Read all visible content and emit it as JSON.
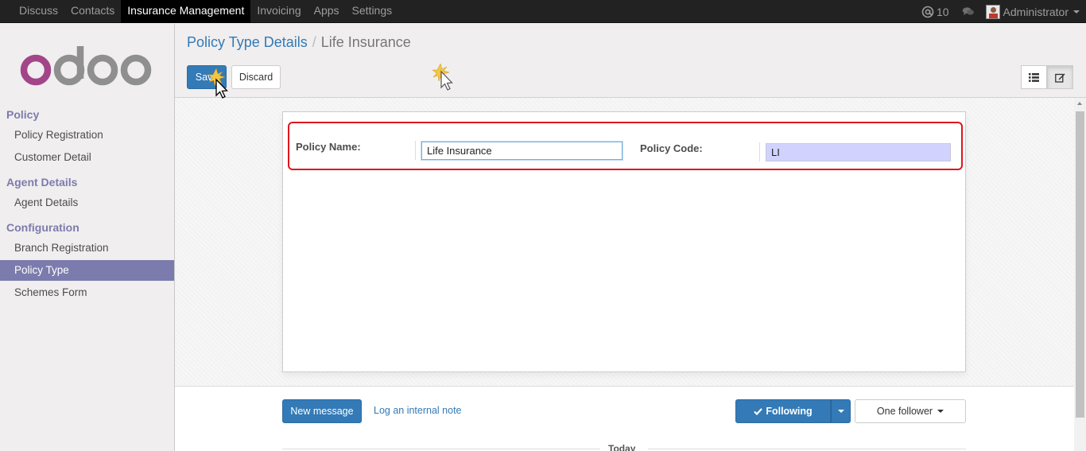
{
  "topbar": {
    "menu": [
      "Discuss",
      "Contacts",
      "Insurance Management",
      "Invoicing",
      "Apps",
      "Settings"
    ],
    "notifications": "10",
    "user": "Administrator",
    "icons": {
      "notif": "at-icon",
      "chat": "chat-icon"
    }
  },
  "sidebar": {
    "logo_text": "odoo",
    "sections": [
      {
        "title": "Policy",
        "items": [
          "Policy Registration",
          "Customer Detail"
        ]
      },
      {
        "title": "Agent Details",
        "items": [
          "Agent Details"
        ]
      },
      {
        "title": "Configuration",
        "items": [
          "Branch Registration",
          "Policy Type",
          "Schemes Form"
        ]
      }
    ],
    "active_item": "Policy Type"
  },
  "breadcrumb": {
    "parent": "Policy Type Details",
    "separator": "/",
    "current": "Life Insurance"
  },
  "buttons": {
    "save": "Save",
    "discard": "Discard"
  },
  "form": {
    "policy_name_label": "Policy Name:",
    "policy_name_value": "Life Insurance",
    "policy_code_label": "Policy Code:",
    "policy_code_value": "LI"
  },
  "chatter": {
    "new_message": "New message",
    "log_note": "Log an internal note",
    "following": "Following",
    "followers": "One follower",
    "today": "Today"
  },
  "colors": {
    "accent": "#7c7bad",
    "primary": "#337ab7",
    "highlight": "#e0141e"
  }
}
